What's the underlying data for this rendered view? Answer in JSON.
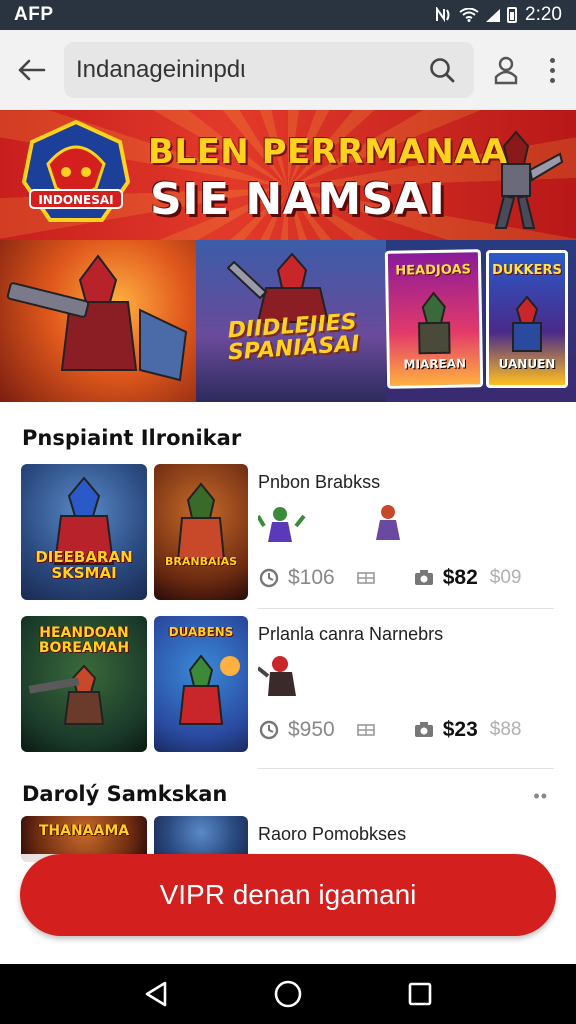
{
  "status_bar": {
    "carrier": "AFP",
    "time": "2:20",
    "icons": [
      "nfc-icon",
      "wifi-icon",
      "signal-icon",
      "battery-icon"
    ]
  },
  "browser": {
    "url": "Indanageininpdι",
    "icons": [
      "back-arrow-icon",
      "search-icon",
      "profile-icon",
      "more-vert-icon"
    ]
  },
  "hero": {
    "emblem_text": "INDONESAI",
    "title_line_1": "BLEN PERRMANAA",
    "title_line_2": "SIE NAMSAI",
    "logo_text_line_1": "DIIDLEJIES",
    "logo_text_line_2": "SPANIASAI",
    "posters": [
      {
        "title": "HEADJOAS",
        "subtitle": "MIAREAN"
      },
      {
        "title": "DUKKERS",
        "subtitle": "UANUEN"
      }
    ]
  },
  "section_1": {
    "title": "Pnspiaint Ilronikar",
    "rows": [
      {
        "thumb_a_label": "DIEEBARAN SKSMAI",
        "thumb_b_label": "BRANBAIAS",
        "title": "Pnbon Brabkss",
        "price_muted": "$106",
        "price_bold": "$82",
        "price_faint": "$09"
      },
      {
        "thumb_a_label": "HEANDOAN BOREAMAH",
        "thumb_b_label": "DUABENS",
        "title": "Prlanla canra Narnebrs",
        "price_muted": "$950",
        "price_bold": "$23",
        "price_faint": "$88"
      }
    ]
  },
  "section_2": {
    "title": "Darolý Samkskan",
    "more": "••",
    "rows": [
      {
        "thumb_a_label": "THANAAMA",
        "title": "Raoro Pomobkses"
      }
    ]
  },
  "cta": {
    "label": "VIPR denan igamani"
  },
  "nav": {
    "icons": [
      "nav-back-icon",
      "nav-home-icon",
      "nav-recents-icon"
    ]
  },
  "colors": {
    "status_bar": "#2a3440",
    "cta": "#d3201f",
    "hero_red": "#c81e1e",
    "hero_yellow": "#ffd21f"
  }
}
